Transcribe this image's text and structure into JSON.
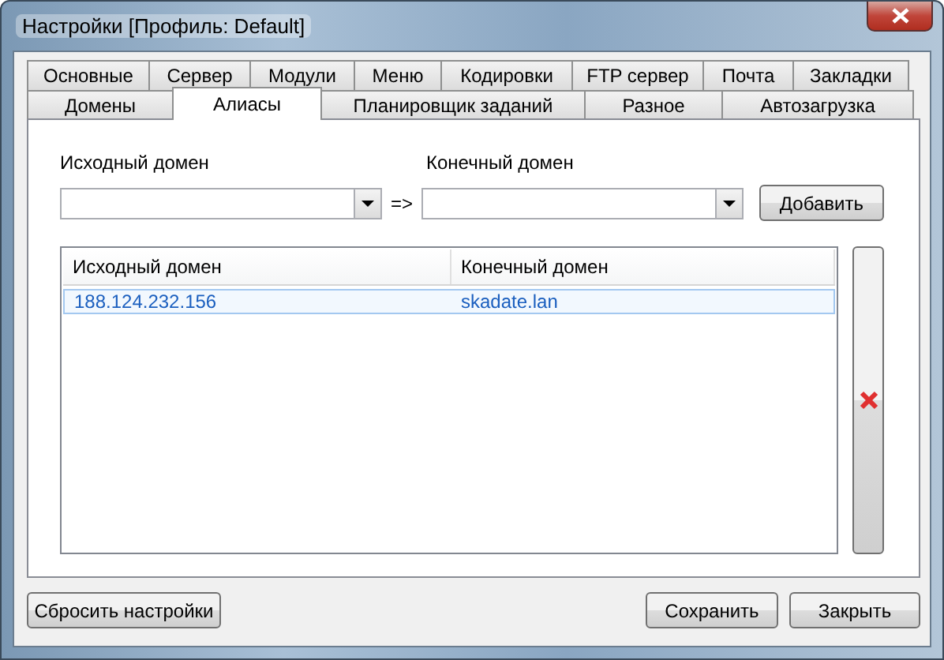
{
  "window": {
    "title": "Настройки [Профиль: Default]"
  },
  "tab_rows": [
    [
      {
        "label": "Основные",
        "selected": false
      },
      {
        "label": "Сервер",
        "selected": false
      },
      {
        "label": "Модули",
        "selected": false
      },
      {
        "label": "Меню",
        "selected": false
      },
      {
        "label": "Кодировки",
        "selected": false
      },
      {
        "label": "FTP сервер",
        "selected": false
      },
      {
        "label": "Почта",
        "selected": false
      },
      {
        "label": "Закладки",
        "selected": false
      }
    ],
    [
      {
        "label": "Домены",
        "selected": false
      },
      {
        "label": "Алиасы",
        "selected": true
      },
      {
        "label": "Планировщик заданий",
        "selected": false
      },
      {
        "label": "Разное",
        "selected": false
      },
      {
        "label": "Автозагрузка",
        "selected": false
      }
    ]
  ],
  "source_field": {
    "label": "Исходный домен"
  },
  "arrow_text": "=>",
  "target_field": {
    "label": "Конечный домен"
  },
  "add_button": "Добавить",
  "alias_list": {
    "columns": [
      "Исходный домен",
      "Конечный домен"
    ],
    "rows": [
      {
        "cells": [
          "188.124.232.156",
          "skadate.lan"
        ],
        "selected": true
      }
    ]
  },
  "buttons": {
    "reset": "Сбросить настройки",
    "save": "Сохранить",
    "close": "Закрыть"
  }
}
